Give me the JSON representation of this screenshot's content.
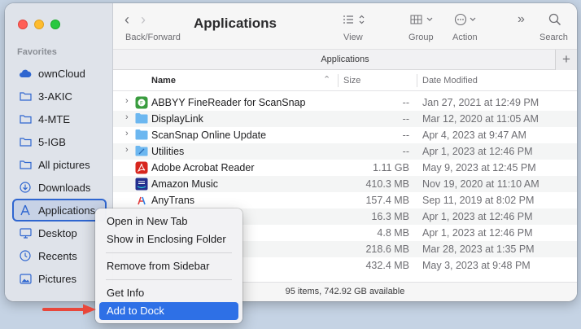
{
  "window": {
    "title": "Applications",
    "path_title": "Applications",
    "status": "95 items, 742.92 GB available"
  },
  "toolbar": {
    "back_forward_label": "Back/Forward",
    "view_label": "View",
    "group_label": "Group",
    "action_label": "Action",
    "search_label": "Search"
  },
  "sidebar": {
    "heading": "Favorites",
    "items": [
      {
        "label": "ownCloud",
        "icon": "cloud-icon"
      },
      {
        "label": "3-AKIC",
        "icon": "folder-icon"
      },
      {
        "label": "4-MTE",
        "icon": "folder-icon"
      },
      {
        "label": "5-IGB",
        "icon": "folder-icon"
      },
      {
        "label": "All pictures",
        "icon": "folder-icon"
      },
      {
        "label": "Downloads",
        "icon": "download-icon"
      },
      {
        "label": "Applications",
        "icon": "applications-icon",
        "selected": true
      },
      {
        "label": "Desktop",
        "icon": "desktop-icon"
      },
      {
        "label": "Recents",
        "icon": "clock-icon"
      },
      {
        "label": "Pictures",
        "icon": "photo-icon"
      }
    ]
  },
  "columns": {
    "name": "Name",
    "size": "Size",
    "date": "Date Modified"
  },
  "files": [
    {
      "name": "ABBYY FineReader for ScanSnap",
      "size": "--",
      "date": "Jan 27, 2021 at 12:49 PM",
      "folder": true
    },
    {
      "name": "DisplayLink",
      "size": "--",
      "date": "Mar 12, 2020 at 11:05 AM",
      "folder": true
    },
    {
      "name": "ScanSnap Online Update",
      "size": "--",
      "date": "Apr 4, 2023 at 9:47 AM",
      "folder": true
    },
    {
      "name": "Utilities",
      "size": "--",
      "date": "Apr 1, 2023 at 12:46 PM",
      "folder": true
    },
    {
      "name": "Adobe Acrobat Reader",
      "size": "1.11 GB",
      "date": "May 9, 2023 at 12:45 PM",
      "folder": false
    },
    {
      "name": "Amazon Music",
      "size": "410.3 MB",
      "date": "Nov 19, 2020 at 11:10 AM",
      "folder": false
    },
    {
      "name": "AnyTrans",
      "size": "157.4 MB",
      "date": "Sep 11, 2019 at 8:02 PM",
      "folder": false
    },
    {
      "name": "",
      "size": "16.3 MB",
      "date": "Apr 1, 2023 at 12:46 PM",
      "folder": false
    },
    {
      "name": "",
      "size": "4.8 MB",
      "date": "Apr 1, 2023 at 12:46 PM",
      "folder": false
    },
    {
      "name": "",
      "size": "218.6 MB",
      "date": "Mar 28, 2023 at 1:35 PM",
      "folder": false
    },
    {
      "name": "",
      "size": "432.4 MB",
      "date": "May 3, 2023 at 9:48 PM",
      "folder": false
    }
  ],
  "context_menu": {
    "items": [
      "Open in New Tab",
      "Show in Enclosing Folder",
      "Remove from Sidebar",
      "Get Info",
      "Add to Dock"
    ]
  },
  "colors": {
    "accent": "#2e70e6",
    "arrow": "#e8473b"
  }
}
